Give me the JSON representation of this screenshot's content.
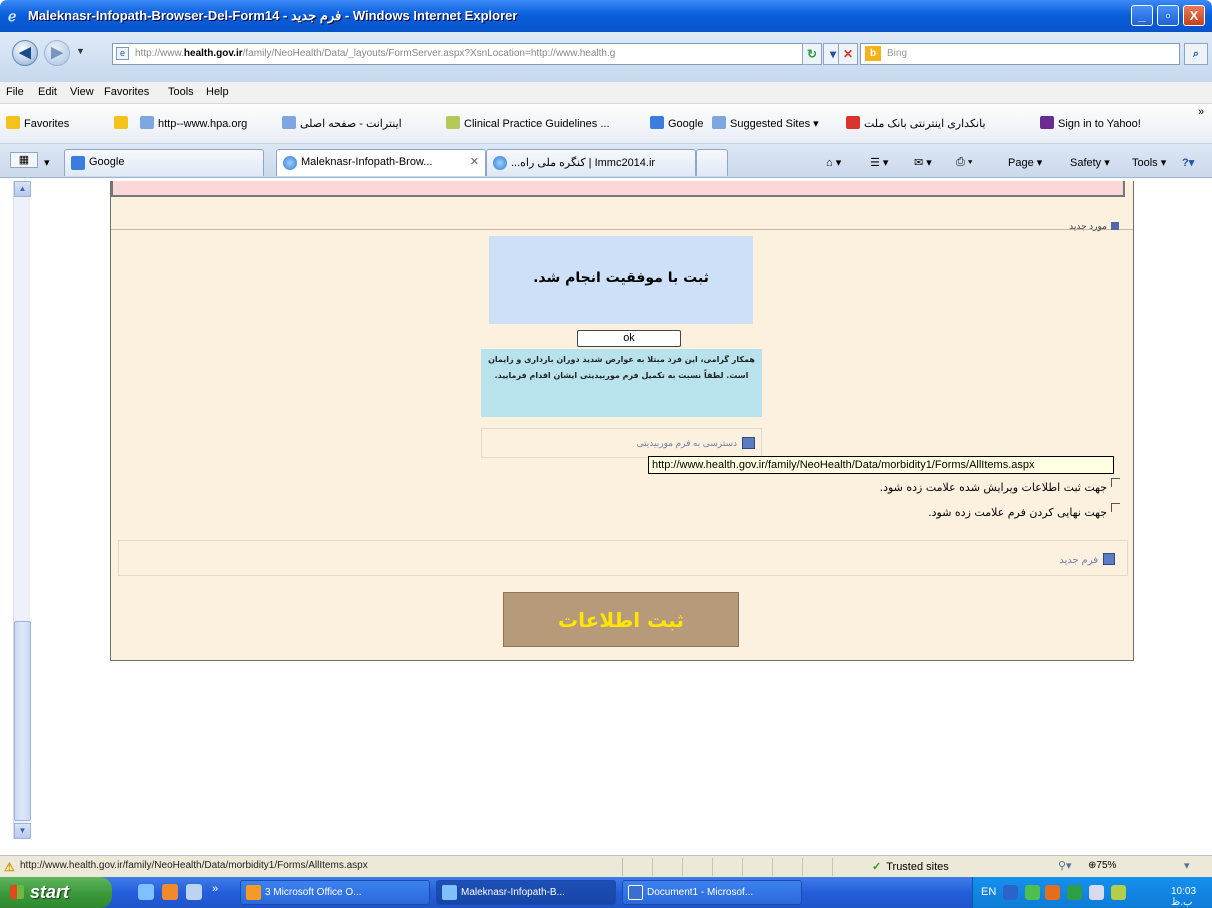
{
  "window": {
    "title": "Maleknasr-Infopath-Browser-Del-Form14 - فرم جدید - Windows Internet Explorer",
    "buttons": [
      "_",
      "▫",
      "X"
    ]
  },
  "address": {
    "url_prefix": "http://www.",
    "url_domain": "health.gov.ir",
    "url_rest": "/family/NeoHealth/Data/_layouts/FormServer.aspx?XsnLocation=http://www.health.g",
    "search_placeholder": "Bing"
  },
  "menu": [
    "File",
    "Edit",
    "View",
    "Favorites",
    "Tools",
    "Help"
  ],
  "favorites": {
    "label": "Favorites",
    "items": [
      "http--www.hpa.org",
      "اینترانت - صفحه اصلی",
      "Clinical Practice Guidelines ...",
      "Google",
      "Suggested Sites ▾",
      "بانکداری اینترنتی بانک ملت",
      "Sign in to Yahoo!"
    ]
  },
  "tabs": {
    "google": "Google",
    "active": "Maleknasr-Infopath-Brow...",
    "second": "...کنگره ملی راه | Immc2014.ir",
    "commands": [
      "Page ▾",
      "Safety ▾",
      "Tools ▾"
    ]
  },
  "form": {
    "new_item_top": "مورد جدید",
    "success_message": "ثبت با موفقیت انجام شد.",
    "ok_label": "ok",
    "warning_text": "همکار گرامی، این فرد مبتلا به عوارض شدید دوران بارداری و زایمان است. لطفاً نسبت به تکمیل فرم موربیدیتی ایشان اقدام فرمایید.",
    "access_link": "دسترسی به فرم موربیدیتی",
    "tooltip": "http://www.health.gov.ir/family/NeoHealth/Data/morbidity1/Forms/AllItems.aspx",
    "check1": "جهت ثبت اطلاعات ویرایش شده علامت زده شود.",
    "check2": "جهت نهایی کردن فرم علامت زده شود.",
    "new_form": "فرم جدید",
    "submit": "ثبت اطلاعات"
  },
  "status": {
    "url": "http://www.health.gov.ir/family/NeoHealth/Data/morbidity1/Forms/AllItems.aspx",
    "zone": "Trusted sites",
    "zoom": "75%"
  },
  "taskbar": {
    "start": "start",
    "items": [
      "3 Microsoft Office O...",
      "Maleknasr-Infopath-B...",
      "Document1 - Microsof..."
    ],
    "lang": "EN",
    "clock": "10:03 ب.ظ"
  }
}
